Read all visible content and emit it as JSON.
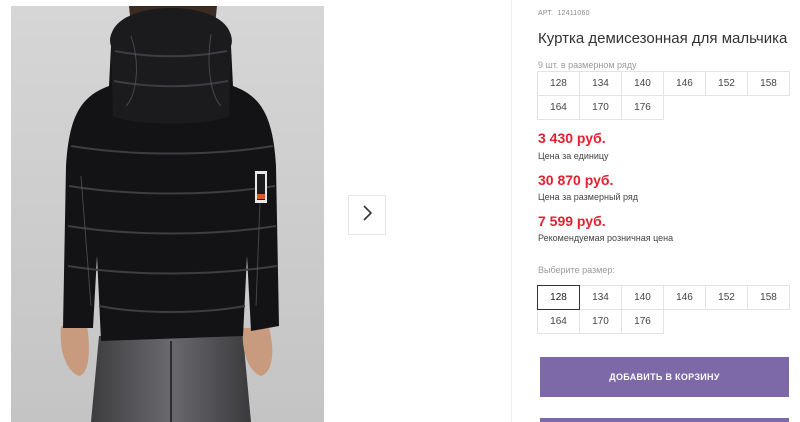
{
  "gallery": {
    "image_alt": "black puffer jacket, back view",
    "next_icon": "chevron-right-icon"
  },
  "product": {
    "article_label": "АРТ.",
    "article_value": "12411060",
    "title": "Куртка демисезонная для мальчика",
    "range_note": "9 шт. в размерном ряду",
    "range_sizes": [
      "128",
      "134",
      "140",
      "146",
      "152",
      "158",
      "164",
      "170",
      "176"
    ]
  },
  "prices": {
    "unit_price": "3 430 руб.",
    "unit_label": "Цена за единицу",
    "range_price": "30 870 руб.",
    "range_label": "Цена за размерный ряд",
    "retail_price": "7 599 руб.",
    "retail_label": "Рекомендуемая розничная цена"
  },
  "size_select": {
    "label": "Выберите размер:",
    "options": [
      "128",
      "134",
      "140",
      "146",
      "152",
      "158",
      "164",
      "170",
      "176"
    ],
    "selected": "128"
  },
  "actions": {
    "add_to_cart": "ДОБАВИТЬ В КОРЗИНУ"
  },
  "colors": {
    "price": "#e5202e",
    "button": "#7d68a8"
  }
}
